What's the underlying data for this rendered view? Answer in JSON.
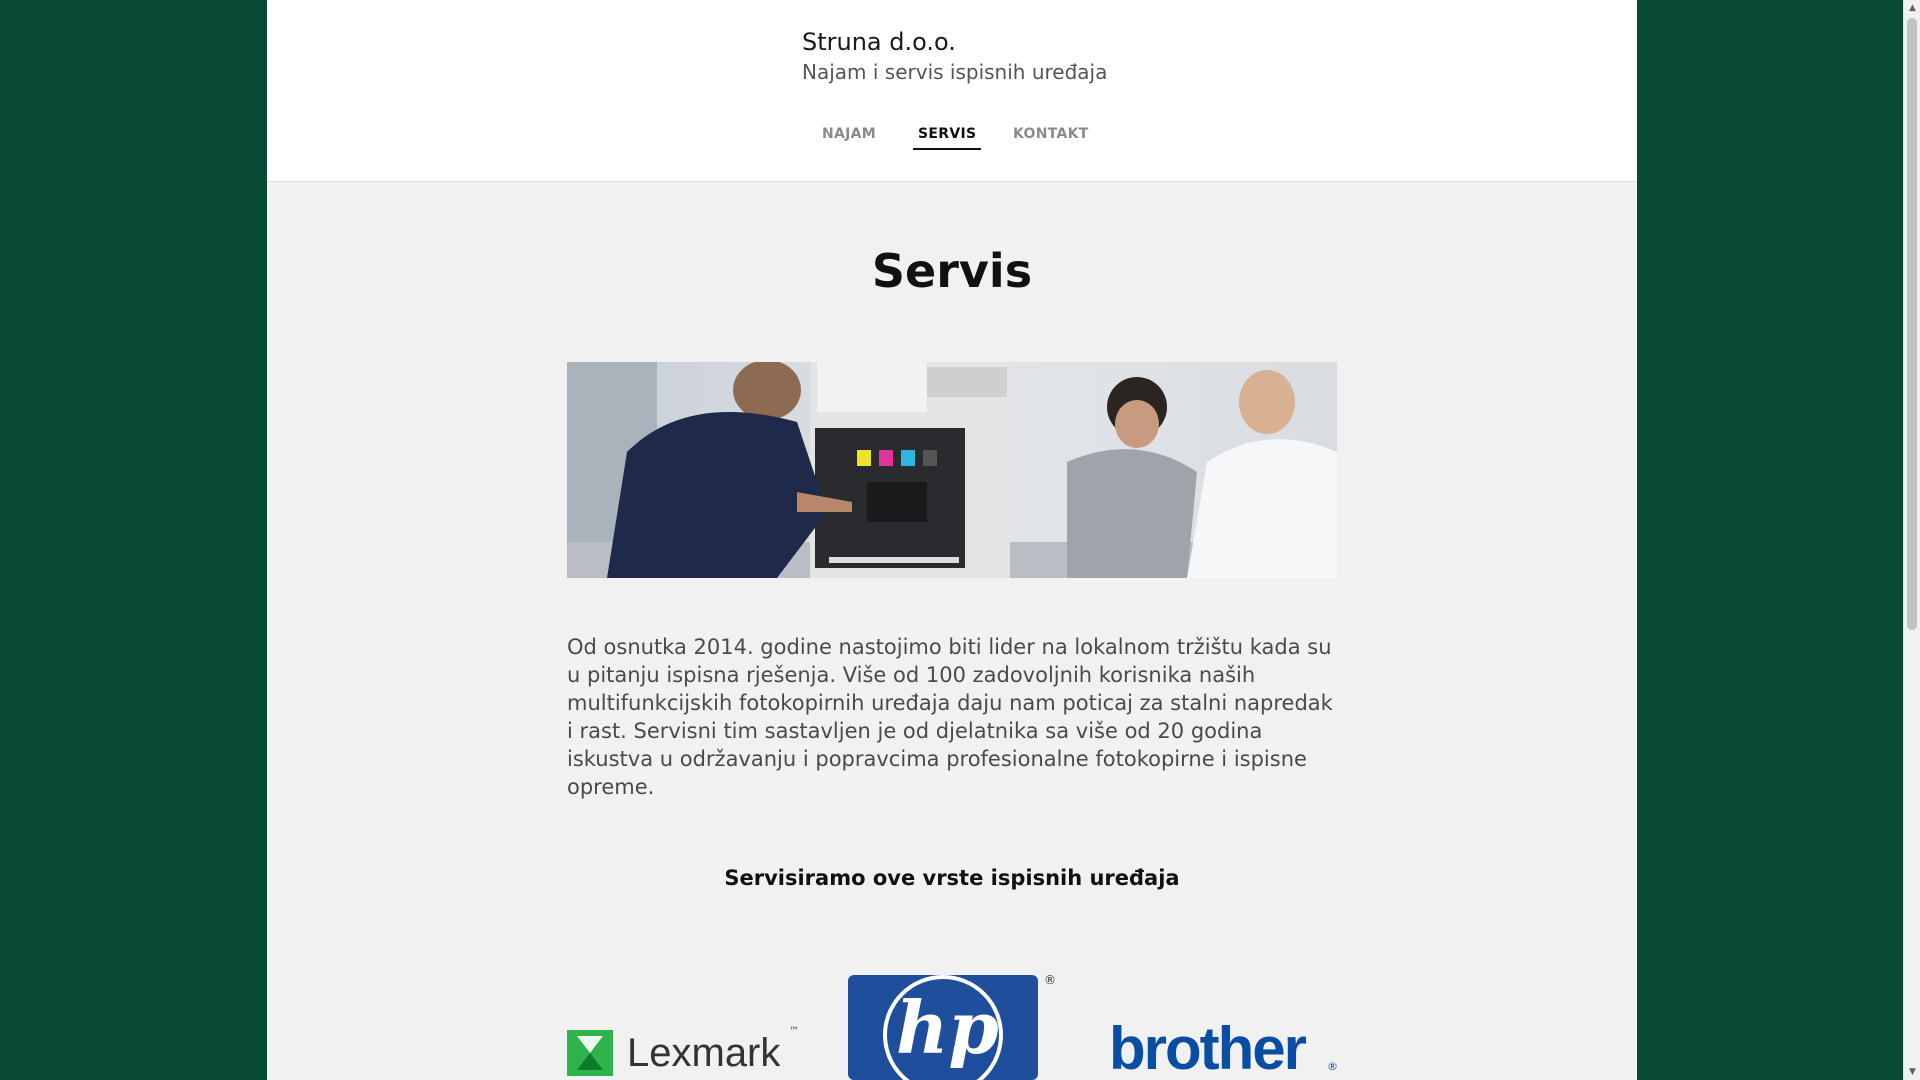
{
  "header": {
    "brand_name": "Struna d.o.o.",
    "tagline": "Najam i servis ispisnih uređaja"
  },
  "nav": {
    "items": [
      {
        "label": "NAJAM",
        "active": false
      },
      {
        "label": "SERVIS",
        "active": true
      },
      {
        "label": "KONTAKT",
        "active": false
      }
    ]
  },
  "main": {
    "title": "Servis",
    "hero_image": "technician-servicing-printer-photo",
    "intro": "Od osnutka 2014. godine nastojimo biti lider na lokalnom tržištu kada su u pitanju ispisna rješenja. Više od 100 zadovoljnih korisnika naših multifunkcijskih fotokopirnih uređaja daju nam poticaj za stalni napredak i rast. Servisni tim sastavljen je od djelatnika sa više od 20 godina iskustva u održavanju i popravcima profesionalne fotokopirne i ispisne opreme.",
    "brands_heading": "Servisiramo ove vrste ispisnih uređaja",
    "brands": [
      {
        "name": "Lexmark",
        "text": "Lexmark",
        "mark": "™",
        "color": "#333333",
        "accent": "#2db34a"
      },
      {
        "name": "hp",
        "text": "hp",
        "mark": "®",
        "color": "#1e4e9c"
      },
      {
        "name": "brother",
        "text": "brother",
        "mark": "®",
        "color": "#0a4ea3"
      }
    ]
  },
  "colors": {
    "background": "#064a36",
    "panel": "#f1f1f1",
    "header": "#ffffff",
    "text_dark": "#111111",
    "nav_inactive": "#8a8a8a"
  }
}
